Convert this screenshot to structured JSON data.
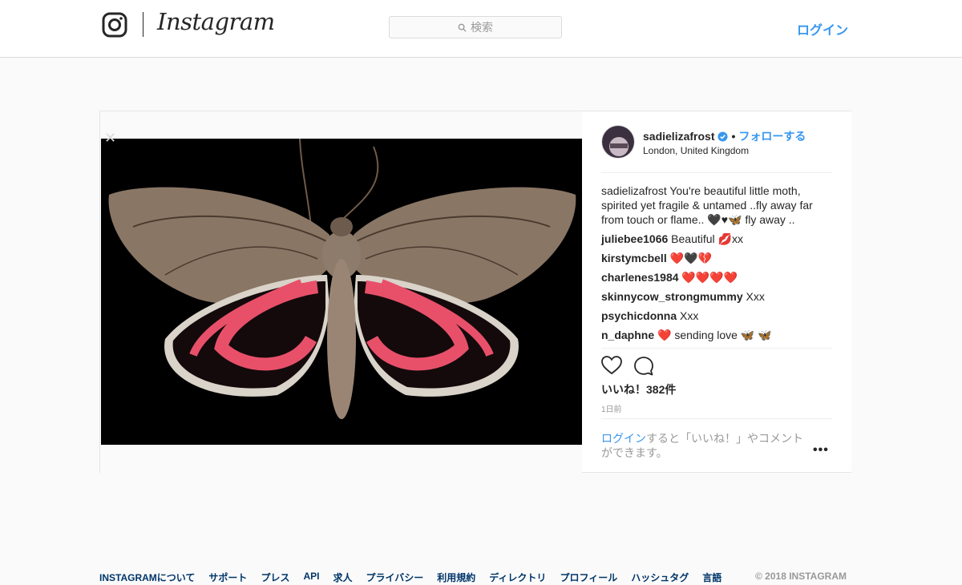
{
  "header": {
    "brand": "Instagram",
    "search_placeholder": "検索",
    "login": "ログイン"
  },
  "post": {
    "username": "sadielizafrost",
    "follow_separator": "•",
    "follow": "フォローする",
    "location": "London, United Kingdom",
    "caption": {
      "user": "sadielizafrost",
      "text": "You're beautiful little moth, spirited yet fragile & untamed ..fly away far from touch or flame.. 🖤♥🦋 fly away .."
    },
    "comments": [
      {
        "user": "juliebee1066",
        "text": "Beautiful 💋xx"
      },
      {
        "user": "kirstymcbell",
        "text": "❤️🖤💔"
      },
      {
        "user": "charlenes1984",
        "text": "❤️❤️❤️❤️"
      },
      {
        "user": "skinnycow_strongmummy",
        "text": "Xxx"
      },
      {
        "user": "psychicdonna",
        "text": "Xxx"
      },
      {
        "user": "n_daphne",
        "text": "❤️ sending love 🦋 🦋"
      }
    ],
    "likes": "いいね！382件",
    "time_ago": "1日前",
    "login_prompt_link": "ログイン",
    "login_prompt_rest": "すると「いいね！」やコメントができます。",
    "more": "•••",
    "close": "✕"
  },
  "footer": {
    "links": [
      "INSTAGRAMについて",
      "サポート",
      "プレス",
      "API",
      "求人",
      "プライバシー",
      "利用規約",
      "ディレクトリ",
      "プロフィール",
      "ハッシュタグ",
      "言語"
    ],
    "copyright": "© 2018 INSTAGRAM"
  },
  "colors": {
    "link_blue": "#3897f0",
    "text": "#262626",
    "muted": "#999999",
    "footer_link": "#003569"
  }
}
